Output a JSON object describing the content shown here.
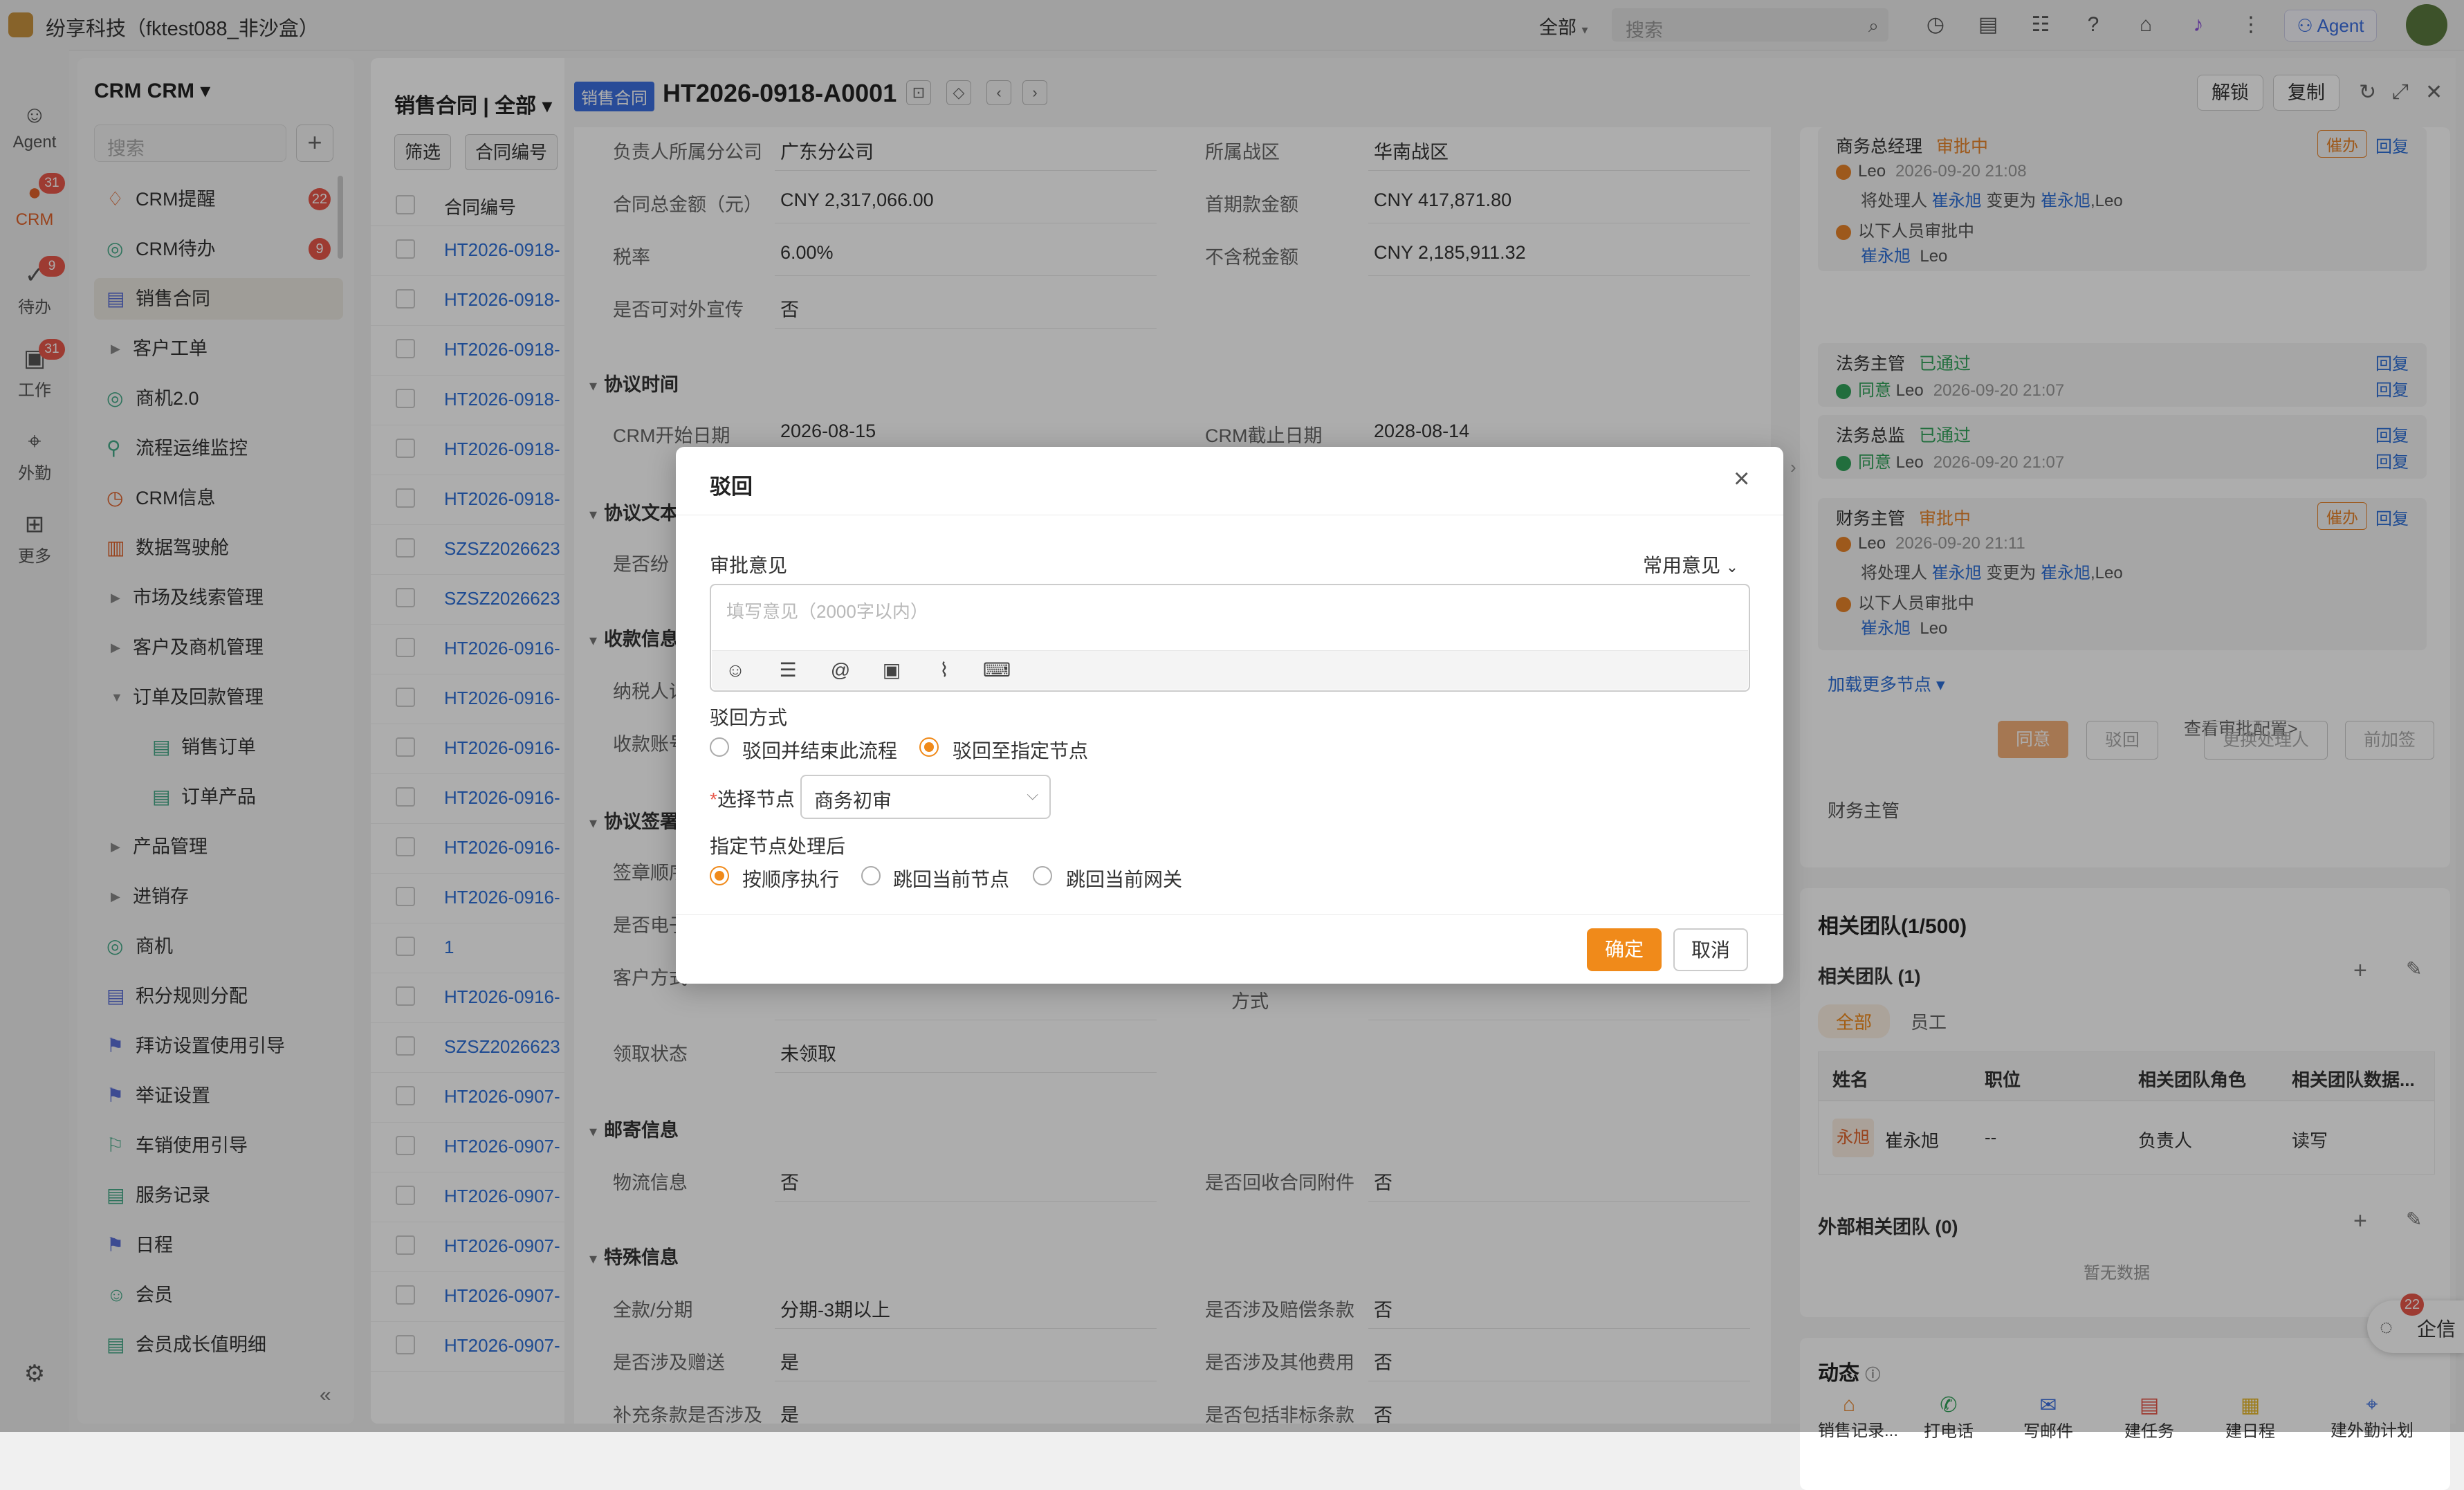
{
  "app": {
    "title": "纷享科技（fktest088_非沙盒）",
    "scope": "全部",
    "search_placeholder": "搜索",
    "agent_label": "Agent"
  },
  "rail": [
    {
      "label": "Agent",
      "icon": "robot-icon"
    },
    {
      "label": "CRM",
      "icon": "crm-icon",
      "badge": "31"
    },
    {
      "label": "待办",
      "icon": "todo-icon",
      "badge": "9"
    },
    {
      "label": "工作",
      "icon": "briefcase-icon",
      "badge": "31"
    },
    {
      "label": "外勤",
      "icon": "location-icon"
    },
    {
      "label": "更多",
      "icon": "grid-icon"
    }
  ],
  "menu": {
    "title": "CRM CRM ▾",
    "search_placeholder": "搜索",
    "items": [
      {
        "label": "CRM提醒",
        "badge": "22"
      },
      {
        "label": "CRM待办",
        "badge": "9"
      },
      {
        "label": "销售合同"
      },
      {
        "label": "客户工单"
      },
      {
        "label": "商机2.0"
      },
      {
        "label": "流程运维监控"
      },
      {
        "label": "CRM信息"
      },
      {
        "label": "数据驾驶舱"
      },
      {
        "label": "市场及线索管理"
      },
      {
        "label": "客户及商机管理"
      },
      {
        "label": "订单及回款管理"
      },
      {
        "label": "销售订单"
      },
      {
        "label": "订单产品"
      },
      {
        "label": "产品管理"
      },
      {
        "label": "进销存"
      },
      {
        "label": "商机"
      },
      {
        "label": "积分规则分配"
      },
      {
        "label": "拜访设置使用引导"
      },
      {
        "label": "举证设置"
      },
      {
        "label": "车销使用引导"
      },
      {
        "label": "服务记录"
      },
      {
        "label": "日程"
      },
      {
        "label": "会员"
      },
      {
        "label": "会员成长值明细"
      }
    ]
  },
  "list": {
    "title": "销售合同 | 全部 ▾",
    "filter_label": "筛选",
    "sort_label": "合同编号",
    "col_header": "合同编号",
    "rows": [
      "HT2026-0918-",
      "HT2026-0918-",
      "HT2026-0918-",
      "HT2026-0918-",
      "HT2026-0918-",
      "HT2026-0918-",
      "SZSZ2026623",
      "SZSZ2026623",
      "HT2026-0916-",
      "HT2026-0916-",
      "HT2026-0916-",
      "HT2026-0916-",
      "HT2026-0916-",
      "HT2026-0916-",
      "1",
      "HT2026-0916-",
      "SZSZ2026623",
      "HT2026-0907-",
      "HT2026-0907-",
      "HT2026-0907-",
      "HT2026-0907-",
      "HT2026-0907-",
      "HT2026-0907-"
    ]
  },
  "detail": {
    "type_tag": "销售合同",
    "contract_no": "HT2026-0918-A0001",
    "unlock_label": "解锁",
    "copy_label": "复制",
    "fields": {
      "branch_label": "负责人所属分公司",
      "branch_value": "广东分公司",
      "war_zone_label": "所属战区",
      "war_zone_value": "华南战区",
      "total_label": "合同总金额（元）",
      "total_value": "CNY 2,317,066.00",
      "first_pay_label": "首期款金额",
      "first_pay_value": "CNY 417,871.80",
      "tax_rate_label": "税率",
      "tax_rate_value": "6.00%",
      "ex_tax_label": "不含税金额",
      "ex_tax_value": "CNY 2,185,911.32",
      "publicity_label": "是否可对外宣传",
      "publicity_value": "否",
      "sec_agreement_time": "协议时间",
      "crm_start_label": "CRM开始日期",
      "crm_start_value": "2026-08-15",
      "crm_end_label": "CRM截止日期",
      "crm_end_value": "2028-08-14",
      "sec_agreement_text": "协议文本",
      "sec_agreement_text_row": "是否纷",
      "sec_payment": "收款信息",
      "payment_row1": "纳税人识",
      "payment_row2": "收款账号",
      "sec_sign": "协议签署",
      "sign_row1": "签章顺序",
      "sign_row2": "是否电子",
      "sign_row3": "客户方式",
      "method_label": "方式",
      "receive_label": "领取状态",
      "receive_value": "未领取",
      "sec_mail": "邮寄信息",
      "logistics_label": "物流信息",
      "logistics_value": "否",
      "return_att_label": "是否回收合同附件",
      "return_att_value": "否",
      "sec_special": "特殊信息",
      "installment_label": "全款/分期",
      "installment_value": "分期-3期以上",
      "compensation_label": "是否涉及赔偿条款",
      "compensation_value": "否",
      "gift_label": "是否涉及赠送",
      "gift_value": "是",
      "other_fee_label": "是否涉及其他费用",
      "other_fee_value": "否",
      "supplement_label": "补充条款是否涉及",
      "supplement_value": "是",
      "non_standard_label": "是否包括非标条款",
      "non_standard_value": "否"
    }
  },
  "approval": {
    "nodes": [
      {
        "role": "商务总经理",
        "status": "审批中",
        "urge": "催办",
        "reply": "回复",
        "user": "Leo",
        "time": "2026-09-20 21:08",
        "change_prefix": "将处理人",
        "from": "崔永旭",
        "change_mid": "变更为",
        "to": "崔永旭",
        "to_suffix": ",Leo",
        "pending_text": "以下人员审批中",
        "pending_users": "崔永旭",
        "pending_users2": "Leo"
      },
      {
        "role": "法务主管",
        "status": "已通过",
        "reply": "回复",
        "agree": "同意",
        "user": "Leo",
        "time": "2026-09-20 21:07"
      },
      {
        "role": "法务总监",
        "status": "已通过",
        "reply": "回复",
        "agree": "同意",
        "user": "Leo",
        "time": "2026-09-20 21:07"
      },
      {
        "role": "财务主管",
        "status": "审批中",
        "urge": "催办",
        "reply": "回复",
        "user": "Leo",
        "time": "2026-09-20 21:11",
        "change_prefix": "将处理人",
        "from": "崔永旭",
        "change_mid": "变更为",
        "to": "崔永旭",
        "to_suffix": ",Leo",
        "pending_text": "以下人员审批中",
        "pending_users": "崔永旭",
        "pending_users2": "Leo"
      }
    ],
    "load_more": "加载更多节点 ▾",
    "view_config": "查看审批配置>",
    "current_node": "财务主管",
    "actions": {
      "agree": "同意",
      "reject": "驳回",
      "change_handler": "更换处理人",
      "add_sign": "前加签"
    }
  },
  "team": {
    "title": "相关团队(1/500)",
    "sub_title": "相关团队 (1)",
    "tab_all": "全部",
    "tab_staff": "员工",
    "columns": [
      "姓名",
      "职位",
      "相关团队角色",
      "相关团队数据..."
    ],
    "row": {
      "avatar": "永旭",
      "name": "崔永旭",
      "position": "--",
      "role": "负责人",
      "permission": "读写"
    },
    "external_title": "外部相关团队 (0)",
    "empty": "暂无数据"
  },
  "activity": {
    "title": "动态",
    "actions": [
      "销售记录...",
      "打电话",
      "写邮件",
      "建任务",
      "建日程",
      "建外勤计划"
    ]
  },
  "chat": {
    "label": "企信",
    "badge": "22"
  },
  "modal": {
    "title": "驳回",
    "opinion_label": "审批意见",
    "common_opinion": "常用意见",
    "opinion_placeholder": "填写意见（2000字以内）",
    "reject_method_label": "驳回方式",
    "option_end": "驳回并结束此流程",
    "option_node": "驳回至指定节点",
    "select_node_label": "选择节点",
    "required_mark": "*",
    "selected_node": "商务初审",
    "after_label": "指定节点处理后",
    "after_seq": "按顺序执行",
    "after_jump_node": "跳回当前节点",
    "after_jump_gateway": "跳回当前网关",
    "ok": "确定",
    "cancel": "取消"
  }
}
